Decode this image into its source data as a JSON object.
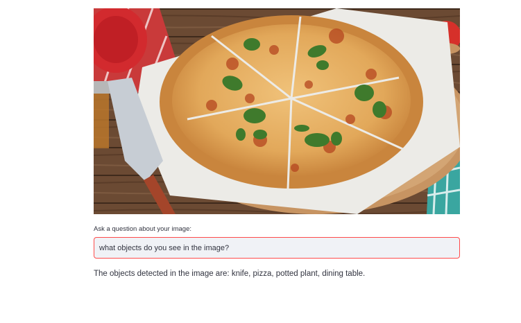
{
  "image": {
    "alt": "pizza",
    "colors": {
      "table": "#6b4a33",
      "paper": "#ecebe7",
      "crust": "#d99a54",
      "cheese": "#e8b46a",
      "sauce": "#b5461f",
      "basil": "#3f7a2c",
      "plate": "#c8282c",
      "board": "#c79462"
    }
  },
  "question": {
    "label": "Ask a question about your image:",
    "value": "what objects do you see in the image?"
  },
  "answer": {
    "text": "The objects detected in the image are: knife, pizza, potted plant, dining table."
  },
  "theme": {
    "accent": "#ff4b4b",
    "input_bg": "#f0f2f6",
    "text": "#31333f"
  }
}
